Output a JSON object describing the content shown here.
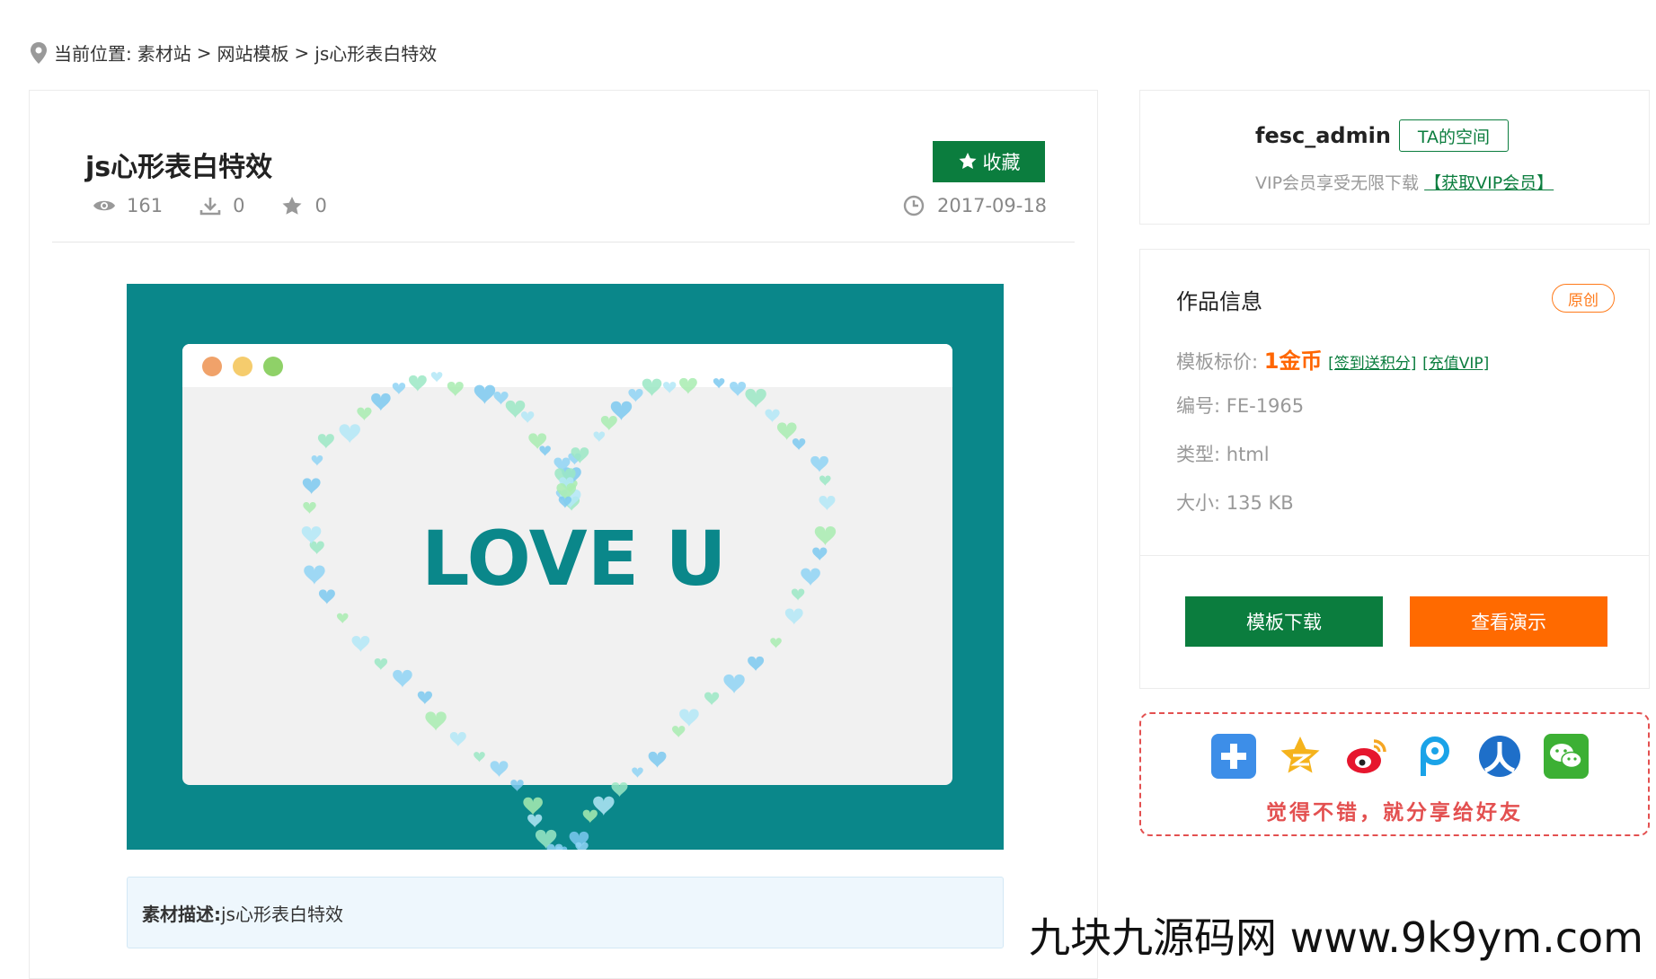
{
  "breadcrumb": {
    "prefix": "当前位置:",
    "items": [
      "素材站",
      "网站模板",
      "js心形表白特效"
    ],
    "separator": ">"
  },
  "item": {
    "title": "js心形表白特效",
    "views": "161",
    "downloads": "0",
    "favorites": "0",
    "favorite_button": "收藏",
    "date": "2017-09-18",
    "description_label": "素材描述:",
    "description": "js心形表白特效"
  },
  "preview": {
    "text": "LOVE U",
    "colors": {
      "background": "#0a878a",
      "window": "#f2f2f2",
      "text": "#0a878a"
    }
  },
  "author": {
    "name": "fesc_admin",
    "space_button": "TA的空间",
    "vip_text": "VIP会员享受无限下载",
    "vip_link": "【获取VIP会员】"
  },
  "info": {
    "title": "作品信息",
    "badge": "原创",
    "price_label": "模板标价:",
    "price": "1金币",
    "checkin_link": "[签到送积分]",
    "recharge_link": "[充值VIP]",
    "id_label": "编号:",
    "id": "FE-1965",
    "type_label": "类型:",
    "type": "html",
    "size_label": "大小:",
    "size": "135 KB",
    "download_button": "模板下载",
    "demo_button": "查看演示"
  },
  "share": {
    "icons": [
      "plus-share-icon",
      "qzone-icon",
      "weibo-icon",
      "pengyou-icon",
      "renren-icon",
      "wechat-icon"
    ],
    "text": "觉得不错，就分享给好友"
  },
  "watermark": "九块九源码网 www.9k9ym.com",
  "colors": {
    "green": "#0b7d3e",
    "orange": "#ff6a00",
    "red": "#e35050"
  }
}
